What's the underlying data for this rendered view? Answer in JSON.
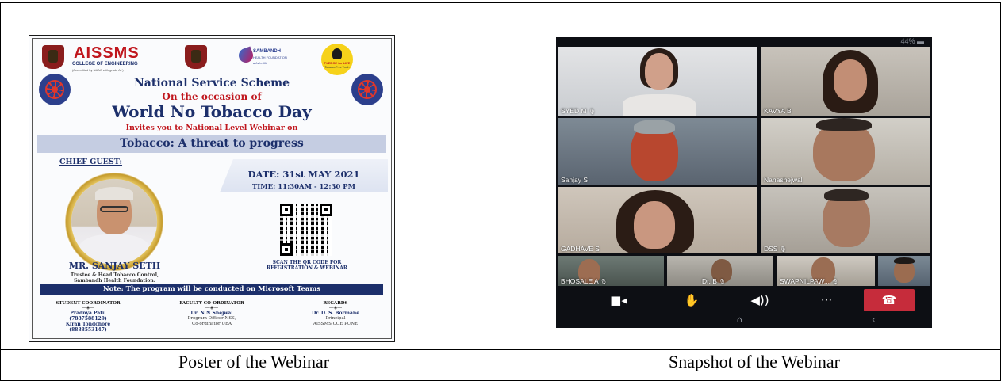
{
  "captions": {
    "left": "Poster of the Webinar",
    "right": "Snapshot of the Webinar"
  },
  "poster": {
    "institute": "AISSMS",
    "institute_sub": "COLLEGE OF ENGINEERING",
    "institute_sub2": "(Accredited by NAAC with grade A+)",
    "partner_logo_text": "SAMBANDH",
    "partner_logo_text2": "HEALTH FOUNDATION",
    "partner_logo_tagline": "a fuller life",
    "pledge_logo_text": "PLEDGE for LIFE",
    "pledge_logo_tagline": "Tobacco Free Youth",
    "scheme": "National Service Scheme",
    "occasion": "On the occasion of",
    "event": "World No Tobacco Day",
    "invite": "Invites you to National Level Webinar on",
    "topic": "Tobacco: A threat to progress",
    "chief_guest_label": "CHIEF GUEST:",
    "date": "DATE: 31st MAY 2021",
    "time": "TIME: 11:30AM - 12:30 PM",
    "guest_name": "MR. SANJAY SETH",
    "guest_title_1": "Trustee & Head Tobacco Control,",
    "guest_title_2": "Sambandh Health Foundation.",
    "scan_1": "SCAN THE QR CODE FOR",
    "scan_2": "RFEGISTRATION & WEBINAR",
    "note": "Note: The program will be conducted on Microsoft Teams",
    "student_coordinator": {
      "heading": "STUDENT COORDINATOR",
      "lines": [
        "Pradnya Patil",
        "(7887588129)",
        "Kiran Tondchore",
        "(8888553147)"
      ]
    },
    "faculty_coordinator": {
      "heading": "FACULTY CO-ORDINATOR",
      "lines": [
        "Dr. N N Shejwal",
        "Program Officer NSS,",
        "Co-ordinator UBA"
      ]
    },
    "regards": {
      "heading": "REGARDS",
      "lines": [
        "Dr. D. S. Bormane",
        "Principal",
        "AISSMS COE PUNE"
      ]
    }
  },
  "snapshot": {
    "battery": "44%",
    "participants": [
      "SYED M",
      "KAVYA B",
      "Sanjay S",
      "Nanashejwal",
      "GADHAVE S",
      "DSS",
      "BHOSALE A",
      "Dr. B",
      "SWAPNILPAW..."
    ],
    "controls": [
      "video-icon",
      "raise-hand-icon",
      "speaker-icon",
      "more-icon",
      "hang-up-icon"
    ],
    "colors": {
      "end_call": "#c62c3b",
      "poster_navy": "#1c2f6b",
      "poster_red": "#c0161d"
    }
  }
}
